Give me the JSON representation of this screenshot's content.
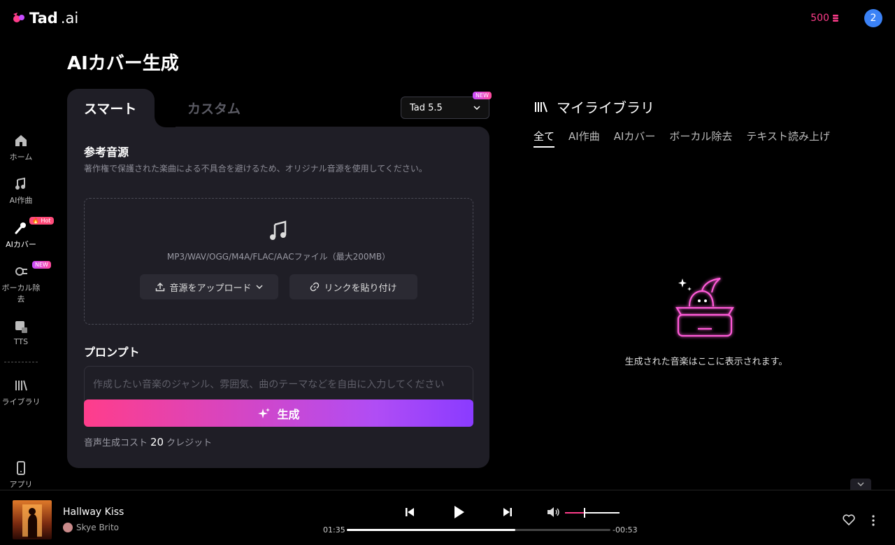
{
  "header": {
    "logo_main": "Tad",
    "logo_suffix": ".ai",
    "credits": "500",
    "avatar_letter": "2"
  },
  "sidebar": {
    "items": [
      {
        "label": "ホーム",
        "icon": "home-icon"
      },
      {
        "label": "AI作曲",
        "icon": "music-note-icon"
      },
      {
        "label": "AIカバー",
        "icon": "microphone-icon",
        "badge": "🔥 Hot"
      },
      {
        "label": "ボーカル除去",
        "icon": "vocal-remove-icon",
        "badge": "NEW"
      },
      {
        "label": "TTS",
        "icon": "tts-icon"
      },
      {
        "label": "ライブラリ",
        "icon": "library-icon"
      },
      {
        "label": "アプリ",
        "icon": "phone-icon"
      }
    ]
  },
  "page": {
    "title": "AIカバー生成"
  },
  "form": {
    "tab_smart": "スマート",
    "tab_custom": "カスタム",
    "model": "Tad 5.5",
    "model_badge": "NEW",
    "source_title": "参考音源",
    "source_desc": "著作権で保護された楽曲による不具合を避けるため、オリジナル音源を使用してください。",
    "formats": "MP3/WAV/OGG/M4A/FLAC/AACファイル（最大200MB）",
    "upload_label": "音源をアップロード",
    "link_label": "リンクを貼り付け",
    "prompt_title": "プロンプト",
    "prompt_placeholder": "作成したい音楽のジャンル、雰囲気、曲のテーマなどを自由に入力してください",
    "generate_label": "生成",
    "cost_prefix": "音声生成コスト",
    "cost_value": "20",
    "cost_suffix": "クレジット"
  },
  "library": {
    "title": "マイライブラリ",
    "tabs": [
      "全て",
      "AI作曲",
      "AIカバー",
      "ボーカル除去",
      "テキスト読み上げ"
    ],
    "empty_text": "生成された音楽はここに表示されます。"
  },
  "player": {
    "song_title": "Hallway Kiss",
    "artist": "Skye Brito",
    "elapsed": "01:35",
    "remaining": "-00:53",
    "progress": 0.64,
    "volume": 0.35
  },
  "colors": {
    "accent_pink": "#ff3d8b",
    "accent_purple": "#8a3bff",
    "panel_bg": "#1f1e26",
    "avatar_blue": "#3b82f6"
  }
}
